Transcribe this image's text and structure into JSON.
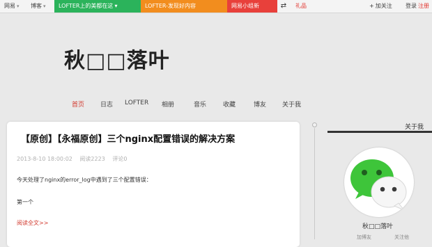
{
  "topbar": {
    "netease": "网易",
    "blog": "博客",
    "lofter1": "LOFTER上的美都在这",
    "lofter2": "LOFTER-发现好内容",
    "group": "网易小组新",
    "gift": "礼品",
    "follow": "加关注",
    "login": "登录",
    "signup": "注册"
  },
  "blog_title": "秋□□落叶",
  "nav": [
    "首页",
    "日志",
    "LOFTER",
    "相册",
    "音乐",
    "收藏",
    "博友",
    "关于我"
  ],
  "post": {
    "title": "【原创】【永福原创】三个nginx配置错误的解决方案",
    "date": "2013-8-10 18:00:02",
    "reads": "阅读2223",
    "comments": "评论0",
    "body": "今天处理了nginx的error_log中遇到了三个配置错误：",
    "body2": "第一个",
    "readmore": "阅读全文>>"
  },
  "sidebar": {
    "about": "关于我",
    "name": "秋□□落叶",
    "stat1": "加博友",
    "stat2": "关注他"
  },
  "colors": {
    "green": "#2bb35b",
    "orange": "#f28d1e",
    "red": "#e8403b",
    "wechat_green": "#3ec53a"
  }
}
